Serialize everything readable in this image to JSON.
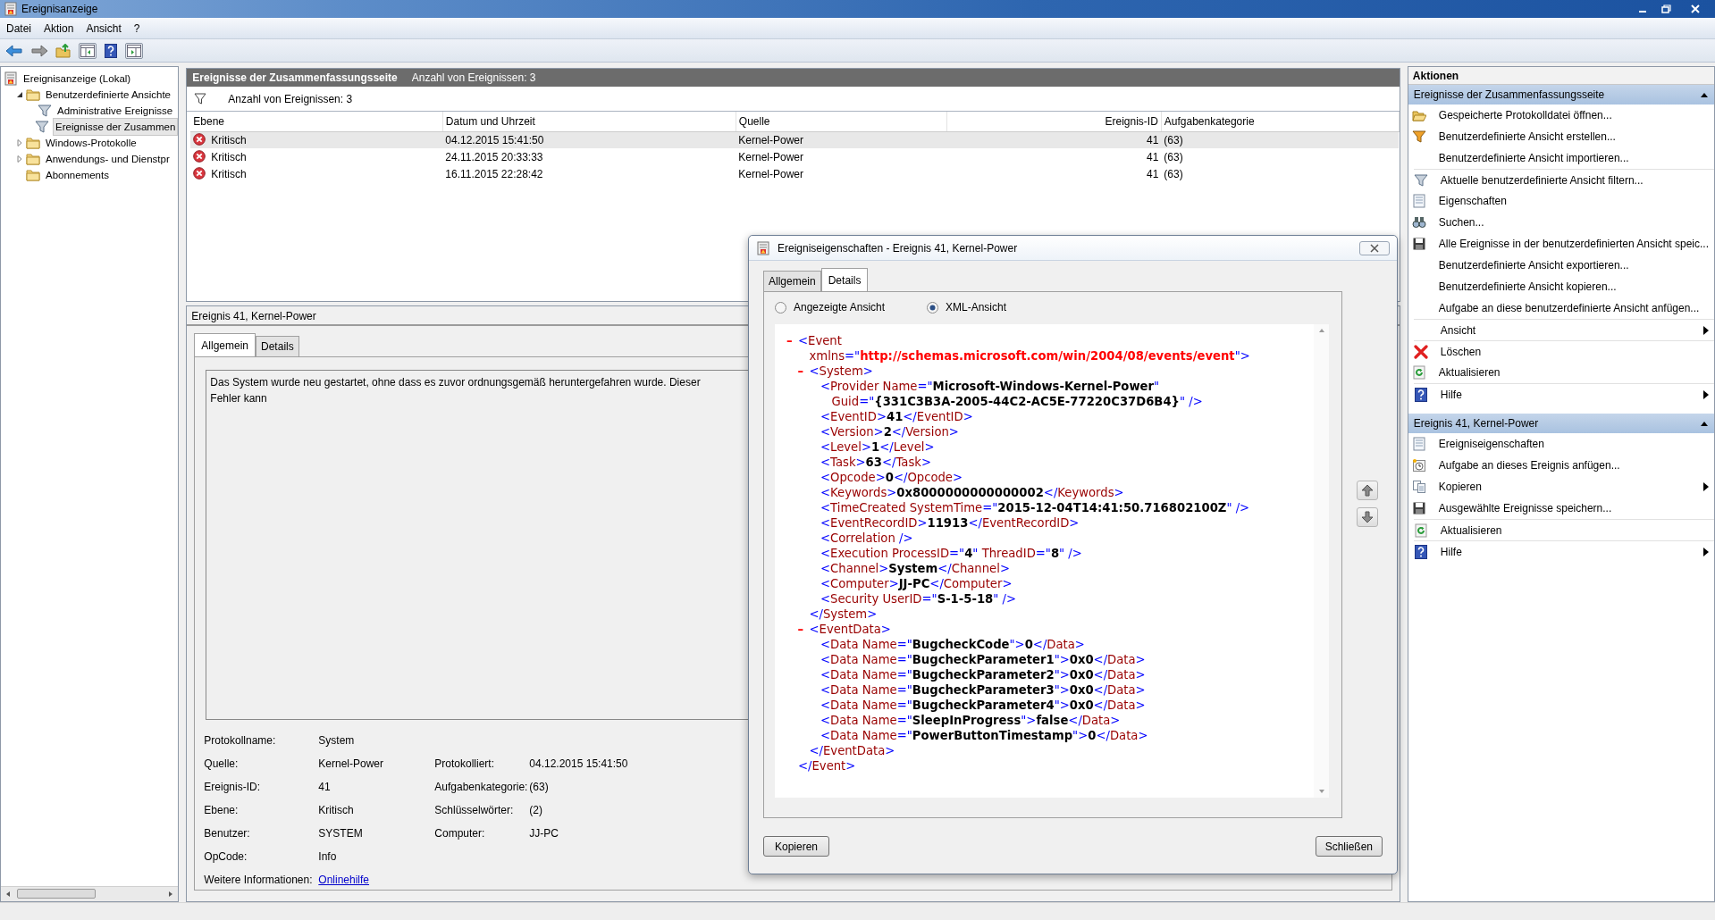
{
  "window": {
    "title": "Ereignisanzeige"
  },
  "menu": [
    "Datei",
    "Aktion",
    "Ansicht",
    "?"
  ],
  "tree": [
    {
      "label": "Ereignisanzeige (Lokal)",
      "kind": "root",
      "selected": false,
      "children": [
        {
          "label": "Benutzerdefinierte Ansichte",
          "kind": "folder",
          "expanded": true,
          "selected": false,
          "children": [
            {
              "label": "Administrative Ereignisse",
              "kind": "filter",
              "selected": false
            },
            {
              "label": "Ereignisse der Zusammen",
              "kind": "filter",
              "selected": true
            }
          ]
        },
        {
          "label": "Windows-Protokolle",
          "kind": "folder",
          "expanded": false,
          "selected": false
        },
        {
          "label": "Anwendungs- und Dienstpr",
          "kind": "folder",
          "expanded": false,
          "selected": false
        },
        {
          "label": "Abonnements",
          "kind": "folder",
          "selected": false
        }
      ]
    }
  ],
  "summary": {
    "title": "Ereignisse der Zusammenfassungsseite",
    "count": "Anzahl von Ereignissen: 3",
    "filter_text": "Anzahl von Ereignissen: 3"
  },
  "events_table": {
    "columns": [
      "Ebene",
      "Datum und Uhrzeit",
      "Quelle",
      "Ereignis-ID",
      "Aufgabenkategorie"
    ],
    "rows": [
      {
        "level": "Kritisch",
        "date": "04.12.2015 15:41:50",
        "source": "Kernel-Power",
        "id": "41",
        "category": "(63)",
        "selected": true
      },
      {
        "level": "Kritisch",
        "date": "24.11.2015 20:33:33",
        "source": "Kernel-Power",
        "id": "41",
        "category": "(63)",
        "selected": false
      },
      {
        "level": "Kritisch",
        "date": "16.11.2015 22:28:42",
        "source": "Kernel-Power",
        "id": "41",
        "category": "(63)",
        "selected": false
      }
    ]
  },
  "event_panel": {
    "title": "Ereignis 41, Kernel-Power",
    "tabs": [
      {
        "label": "Allgemein",
        "selected": true
      },
      {
        "label": "Details",
        "selected": false
      }
    ],
    "description": "Das System wurde neu gestartet, ohne dass es zuvor ordnungsgemäß heruntergefahren wurde. Dieser Fehler kann",
    "properties": [
      {
        "left": {
          "label": "Protokollname:",
          "value": "System"
        }
      },
      {
        "left": {
          "label": "Quelle:",
          "value": "Kernel-Power"
        },
        "right": {
          "label": "Protokolliert:",
          "value": "04.12.2015 15:41:50"
        }
      },
      {
        "left": {
          "label": "Ereignis-ID:",
          "value": "41"
        },
        "right": {
          "label": "Aufgabenkategorie:",
          "value": "(63)"
        }
      },
      {
        "left": {
          "label": "Ebene:",
          "value": "Kritisch"
        },
        "right": {
          "label": "Schlüsselwörter:",
          "value": "(2)"
        }
      },
      {
        "left": {
          "label": "Benutzer:",
          "value": "SYSTEM"
        },
        "right": {
          "label": "Computer:",
          "value": "JJ-PC"
        }
      },
      {
        "left": {
          "label": "OpCode:",
          "value": "Info"
        }
      },
      {
        "left": {
          "label": "Weitere Informationen:",
          "link": "Onlinehilfe"
        }
      }
    ]
  },
  "dialog": {
    "title": "Ereigniseigenschaften - Ereignis 41, Kernel-Power",
    "tabs": [
      {
        "label": "Allgemein",
        "selected": false
      },
      {
        "label": "Details",
        "selected": true
      }
    ],
    "views": [
      {
        "label": "Angezeigte Ansicht",
        "selected": false
      },
      {
        "label": "XML-Ansicht",
        "selected": true
      }
    ],
    "xml": [
      {
        "toggle": "–",
        "open": [
          [
            {
              "kind": "punct",
              "text": "<"
            },
            {
              "kind": "name",
              "text": "Event"
            }
          ],
          [
            {
              "kind": "name",
              "text": "xmlns"
            },
            {
              "kind": "punct",
              "text": "=\""
            },
            {
              "kind": "url",
              "text": "http://schemas.microsoft.com/win/2004/08/events/event"
            },
            {
              "kind": "punct",
              "text": "\">"
            }
          ]
        ],
        "children": [
          {
            "toggle": "–",
            "open": [
              [
                {
                  "kind": "punct",
                  "text": "<"
                },
                {
                  "kind": "name",
                  "text": "System"
                },
                {
                  "kind": "punct",
                  "text": ">"
                }
              ]
            ],
            "children": [
              {
                "open": [
                  [
                    {
                      "kind": "punct",
                      "text": "<"
                    },
                    {
                      "kind": "name",
                      "text": "Provider Name"
                    },
                    {
                      "kind": "punct",
                      "text": "=\""
                    },
                    {
                      "kind": "value",
                      "text": "Microsoft-Windows-Kernel-Power"
                    },
                    {
                      "kind": "punct",
                      "text": "\""
                    }
                  ],
                  [
                    {
                      "kind": "name",
                      "text": "Guid"
                    },
                    {
                      "kind": "punct",
                      "text": "=\""
                    },
                    {
                      "kind": "value",
                      "text": "{331C3B3A-2005-44C2-AC5E-77220C37D6B4}"
                    },
                    {
                      "kind": "punct",
                      "text": "\" />"
                    }
                  ]
                ]
              },
              {
                "open": [
                  [
                    {
                      "kind": "punct",
                      "text": "<"
                    },
                    {
                      "kind": "name",
                      "text": "EventID"
                    },
                    {
                      "kind": "punct",
                      "text": ">"
                    },
                    {
                      "kind": "value",
                      "text": "41"
                    },
                    {
                      "kind": "punct",
                      "text": "</"
                    },
                    {
                      "kind": "name",
                      "text": "EventID"
                    },
                    {
                      "kind": "punct",
                      "text": ">"
                    }
                  ]
                ]
              },
              {
                "open": [
                  [
                    {
                      "kind": "punct",
                      "text": "<"
                    },
                    {
                      "kind": "name",
                      "text": "Version"
                    },
                    {
                      "kind": "punct",
                      "text": ">"
                    },
                    {
                      "kind": "value",
                      "text": "2"
                    },
                    {
                      "kind": "punct",
                      "text": "</"
                    },
                    {
                      "kind": "name",
                      "text": "Version"
                    },
                    {
                      "kind": "punct",
                      "text": ">"
                    }
                  ]
                ]
              },
              {
                "open": [
                  [
                    {
                      "kind": "punct",
                      "text": "<"
                    },
                    {
                      "kind": "name",
                      "text": "Level"
                    },
                    {
                      "kind": "punct",
                      "text": ">"
                    },
                    {
                      "kind": "value",
                      "text": "1"
                    },
                    {
                      "kind": "punct",
                      "text": "</"
                    },
                    {
                      "kind": "name",
                      "text": "Level"
                    },
                    {
                      "kind": "punct",
                      "text": ">"
                    }
                  ]
                ]
              },
              {
                "open": [
                  [
                    {
                      "kind": "punct",
                      "text": "<"
                    },
                    {
                      "kind": "name",
                      "text": "Task"
                    },
                    {
                      "kind": "punct",
                      "text": ">"
                    },
                    {
                      "kind": "value",
                      "text": "63"
                    },
                    {
                      "kind": "punct",
                      "text": "</"
                    },
                    {
                      "kind": "name",
                      "text": "Task"
                    },
                    {
                      "kind": "punct",
                      "text": ">"
                    }
                  ]
                ]
              },
              {
                "open": [
                  [
                    {
                      "kind": "punct",
                      "text": "<"
                    },
                    {
                      "kind": "name",
                      "text": "Opcode"
                    },
                    {
                      "kind": "punct",
                      "text": ">"
                    },
                    {
                      "kind": "value",
                      "text": "0"
                    },
                    {
                      "kind": "punct",
                      "text": "</"
                    },
                    {
                      "kind": "name",
                      "text": "Opcode"
                    },
                    {
                      "kind": "punct",
                      "text": ">"
                    }
                  ]
                ]
              },
              {
                "open": [
                  [
                    {
                      "kind": "punct",
                      "text": "<"
                    },
                    {
                      "kind": "name",
                      "text": "Keywords"
                    },
                    {
                      "kind": "punct",
                      "text": ">"
                    },
                    {
                      "kind": "value",
                      "text": "0x8000000000000002"
                    },
                    {
                      "kind": "punct",
                      "text": "</"
                    },
                    {
                      "kind": "name",
                      "text": "Keywords"
                    },
                    {
                      "kind": "punct",
                      "text": ">"
                    }
                  ]
                ]
              },
              {
                "open": [
                  [
                    {
                      "kind": "punct",
                      "text": "<"
                    },
                    {
                      "kind": "name",
                      "text": "TimeCreated SystemTime"
                    },
                    {
                      "kind": "punct",
                      "text": "=\""
                    },
                    {
                      "kind": "value",
                      "text": "2015-12-04T14:41:50.716802100Z"
                    },
                    {
                      "kind": "punct",
                      "text": "\" />"
                    }
                  ]
                ]
              },
              {
                "open": [
                  [
                    {
                      "kind": "punct",
                      "text": "<"
                    },
                    {
                      "kind": "name",
                      "text": "EventRecordID"
                    },
                    {
                      "kind": "punct",
                      "text": ">"
                    },
                    {
                      "kind": "value",
                      "text": "11913"
                    },
                    {
                      "kind": "punct",
                      "text": "</"
                    },
                    {
                      "kind": "name",
                      "text": "EventRecordID"
                    },
                    {
                      "kind": "punct",
                      "text": ">"
                    }
                  ]
                ]
              },
              {
                "open": [
                  [
                    {
                      "kind": "punct",
                      "text": "<"
                    },
                    {
                      "kind": "name",
                      "text": "Correlation"
                    },
                    {
                      "kind": "punct",
                      "text": " />"
                    }
                  ]
                ]
              },
              {
                "open": [
                  [
                    {
                      "kind": "punct",
                      "text": "<"
                    },
                    {
                      "kind": "name",
                      "text": "Execution ProcessID"
                    },
                    {
                      "kind": "punct",
                      "text": "=\""
                    },
                    {
                      "kind": "value",
                      "text": "4"
                    },
                    {
                      "kind": "punct",
                      "text": "\" "
                    },
                    {
                      "kind": "name",
                      "text": "ThreadID"
                    },
                    {
                      "kind": "punct",
                      "text": "=\""
                    },
                    {
                      "kind": "value",
                      "text": "8"
                    },
                    {
                      "kind": "punct",
                      "text": "\" />"
                    }
                  ]
                ]
              },
              {
                "open": [
                  [
                    {
                      "kind": "punct",
                      "text": "<"
                    },
                    {
                      "kind": "name",
                      "text": "Channel"
                    },
                    {
                      "kind": "punct",
                      "text": ">"
                    },
                    {
                      "kind": "value",
                      "text": "System"
                    },
                    {
                      "kind": "punct",
                      "text": "</"
                    },
                    {
                      "kind": "name",
                      "text": "Channel"
                    },
                    {
                      "kind": "punct",
                      "text": ">"
                    }
                  ]
                ]
              },
              {
                "open": [
                  [
                    {
                      "kind": "punct",
                      "text": "<"
                    },
                    {
                      "kind": "name",
                      "text": "Computer"
                    },
                    {
                      "kind": "punct",
                      "text": ">"
                    },
                    {
                      "kind": "value",
                      "text": "JJ-PC"
                    },
                    {
                      "kind": "punct",
                      "text": "</"
                    },
                    {
                      "kind": "name",
                      "text": "Computer"
                    },
                    {
                      "kind": "punct",
                      "text": ">"
                    }
                  ]
                ]
              },
              {
                "open": [
                  [
                    {
                      "kind": "punct",
                      "text": "<"
                    },
                    {
                      "kind": "name",
                      "text": "Security UserID"
                    },
                    {
                      "kind": "punct",
                      "text": "=\""
                    },
                    {
                      "kind": "value",
                      "text": "S-1-5-18"
                    },
                    {
                      "kind": "punct",
                      "text": "\" />"
                    }
                  ]
                ]
              }
            ],
            "close": [
              {
                "kind": "punct",
                "text": "</"
              },
              {
                "kind": "name",
                "text": "System"
              },
              {
                "kind": "punct",
                "text": ">"
              }
            ]
          },
          {
            "toggle": "–",
            "open": [
              [
                {
                  "kind": "punct",
                  "text": "<"
                },
                {
                  "kind": "name",
                  "text": "EventData"
                },
                {
                  "kind": "punct",
                  "text": ">"
                }
              ]
            ],
            "children": [
              {
                "open": [
                  [
                    {
                      "kind": "punct",
                      "text": "<"
                    },
                    {
                      "kind": "name",
                      "text": "Data Name"
                    },
                    {
                      "kind": "punct",
                      "text": "=\""
                    },
                    {
                      "kind": "value",
                      "text": "BugcheckCode"
                    },
                    {
                      "kind": "punct",
                      "text": "\">"
                    },
                    {
                      "kind": "value",
                      "text": "0"
                    },
                    {
                      "kind": "punct",
                      "text": "</"
                    },
                    {
                      "kind": "name",
                      "text": "Data"
                    },
                    {
                      "kind": "punct",
                      "text": ">"
                    }
                  ]
                ]
              },
              {
                "open": [
                  [
                    {
                      "kind": "punct",
                      "text": "<"
                    },
                    {
                      "kind": "name",
                      "text": "Data Name"
                    },
                    {
                      "kind": "punct",
                      "text": "=\""
                    },
                    {
                      "kind": "value",
                      "text": "BugcheckParameter1"
                    },
                    {
                      "kind": "punct",
                      "text": "\">"
                    },
                    {
                      "kind": "value",
                      "text": "0x0"
                    },
                    {
                      "kind": "punct",
                      "text": "</"
                    },
                    {
                      "kind": "name",
                      "text": "Data"
                    },
                    {
                      "kind": "punct",
                      "text": ">"
                    }
                  ]
                ]
              },
              {
                "open": [
                  [
                    {
                      "kind": "punct",
                      "text": "<"
                    },
                    {
                      "kind": "name",
                      "text": "Data Name"
                    },
                    {
                      "kind": "punct",
                      "text": "=\""
                    },
                    {
                      "kind": "value",
                      "text": "BugcheckParameter2"
                    },
                    {
                      "kind": "punct",
                      "text": "\">"
                    },
                    {
                      "kind": "value",
                      "text": "0x0"
                    },
                    {
                      "kind": "punct",
                      "text": "</"
                    },
                    {
                      "kind": "name",
                      "text": "Data"
                    },
                    {
                      "kind": "punct",
                      "text": ">"
                    }
                  ]
                ]
              },
              {
                "open": [
                  [
                    {
                      "kind": "punct",
                      "text": "<"
                    },
                    {
                      "kind": "name",
                      "text": "Data Name"
                    },
                    {
                      "kind": "punct",
                      "text": "=\""
                    },
                    {
                      "kind": "value",
                      "text": "BugcheckParameter3"
                    },
                    {
                      "kind": "punct",
                      "text": "\">"
                    },
                    {
                      "kind": "value",
                      "text": "0x0"
                    },
                    {
                      "kind": "punct",
                      "text": "</"
                    },
                    {
                      "kind": "name",
                      "text": "Data"
                    },
                    {
                      "kind": "punct",
                      "text": ">"
                    }
                  ]
                ]
              },
              {
                "open": [
                  [
                    {
                      "kind": "punct",
                      "text": "<"
                    },
                    {
                      "kind": "name",
                      "text": "Data Name"
                    },
                    {
                      "kind": "punct",
                      "text": "=\""
                    },
                    {
                      "kind": "value",
                      "text": "BugcheckParameter4"
                    },
                    {
                      "kind": "punct",
                      "text": "\">"
                    },
                    {
                      "kind": "value",
                      "text": "0x0"
                    },
                    {
                      "kind": "punct",
                      "text": "</"
                    },
                    {
                      "kind": "name",
                      "text": "Data"
                    },
                    {
                      "kind": "punct",
                      "text": ">"
                    }
                  ]
                ]
              },
              {
                "open": [
                  [
                    {
                      "kind": "punct",
                      "text": "<"
                    },
                    {
                      "kind": "name",
                      "text": "Data Name"
                    },
                    {
                      "kind": "punct",
                      "text": "=\""
                    },
                    {
                      "kind": "value",
                      "text": "SleepInProgress"
                    },
                    {
                      "kind": "punct",
                      "text": "\">"
                    },
                    {
                      "kind": "value",
                      "text": "false"
                    },
                    {
                      "kind": "punct",
                      "text": "</"
                    },
                    {
                      "kind": "name",
                      "text": "Data"
                    },
                    {
                      "kind": "punct",
                      "text": ">"
                    }
                  ]
                ]
              },
              {
                "open": [
                  [
                    {
                      "kind": "punct",
                      "text": "<"
                    },
                    {
                      "kind": "name",
                      "text": "Data Name"
                    },
                    {
                      "kind": "punct",
                      "text": "=\""
                    },
                    {
                      "kind": "value",
                      "text": "PowerButtonTimestamp"
                    },
                    {
                      "kind": "punct",
                      "text": "\">"
                    },
                    {
                      "kind": "value",
                      "text": "0"
                    },
                    {
                      "kind": "punct",
                      "text": "</"
                    },
                    {
                      "kind": "name",
                      "text": "Data"
                    },
                    {
                      "kind": "punct",
                      "text": ">"
                    }
                  ]
                ]
              }
            ],
            "close": [
              {
                "kind": "punct",
                "text": "</"
              },
              {
                "kind": "name",
                "text": "EventData"
              },
              {
                "kind": "punct",
                "text": ">"
              }
            ]
          }
        ],
        "close": [
          {
            "kind": "punct",
            "text": "</"
          },
          {
            "kind": "name",
            "text": "Event"
          },
          {
            "kind": "punct",
            "text": ">"
          }
        ]
      }
    ],
    "buttons": [
      "Kopieren",
      "Schließen"
    ]
  },
  "actions": {
    "title": "Aktionen",
    "sections": [
      {
        "title": "Ereignisse der Zusammenfassungsseite",
        "expanded": true,
        "items": [
          {
            "label": "Gespeicherte Protokolldatei öffnen...",
            "kind": "open"
          },
          {
            "label": "Benutzerdefinierte Ansicht erstellen...",
            "kind": "create-filter"
          },
          {
            "label": "Benutzerdefinierte Ansicht importieren...",
            "kind": "plain"
          },
          {
            "label": "Aktuelle benutzerdefinierte Ansicht filtern...",
            "kind": "filter",
            "divider_above": true
          },
          {
            "label": "Eigenschaften",
            "kind": "properties"
          },
          {
            "label": "Suchen...",
            "kind": "find"
          },
          {
            "label": "Alle Ereignisse in der benutzerdefinierten Ansicht speic...",
            "kind": "save"
          },
          {
            "label": "Benutzerdefinierte Ansicht exportieren...",
            "kind": "plain"
          },
          {
            "label": "Benutzerdefinierte Ansicht kopieren...",
            "kind": "plain"
          },
          {
            "label": "Aufgabe an diese benutzerdefinierte Ansicht anfügen...",
            "kind": "plain"
          },
          {
            "label": "Ansicht",
            "kind": "plain",
            "submenu": true,
            "divider_above": true
          },
          {
            "label": "Löschen",
            "kind": "delete",
            "divider_above": true
          },
          {
            "label": "Aktualisieren",
            "kind": "refresh"
          },
          {
            "label": "Hilfe",
            "kind": "help",
            "submenu": true,
            "divider_above": true
          }
        ]
      },
      {
        "title": "Ereignis 41, Kernel-Power",
        "expanded": true,
        "items": [
          {
            "label": "Ereigniseigenschaften",
            "kind": "properties"
          },
          {
            "label": "Aufgabe an dieses Ereignis anfügen...",
            "kind": "task"
          },
          {
            "label": "Kopieren",
            "kind": "copy",
            "submenu": true
          },
          {
            "label": "Ausgewählte Ereignisse speichern...",
            "kind": "save"
          },
          {
            "label": "Aktualisieren",
            "kind": "refresh",
            "divider_above": true
          },
          {
            "label": "Hilfe",
            "kind": "help",
            "submenu": true,
            "divider_above": true
          }
        ]
      }
    ]
  }
}
